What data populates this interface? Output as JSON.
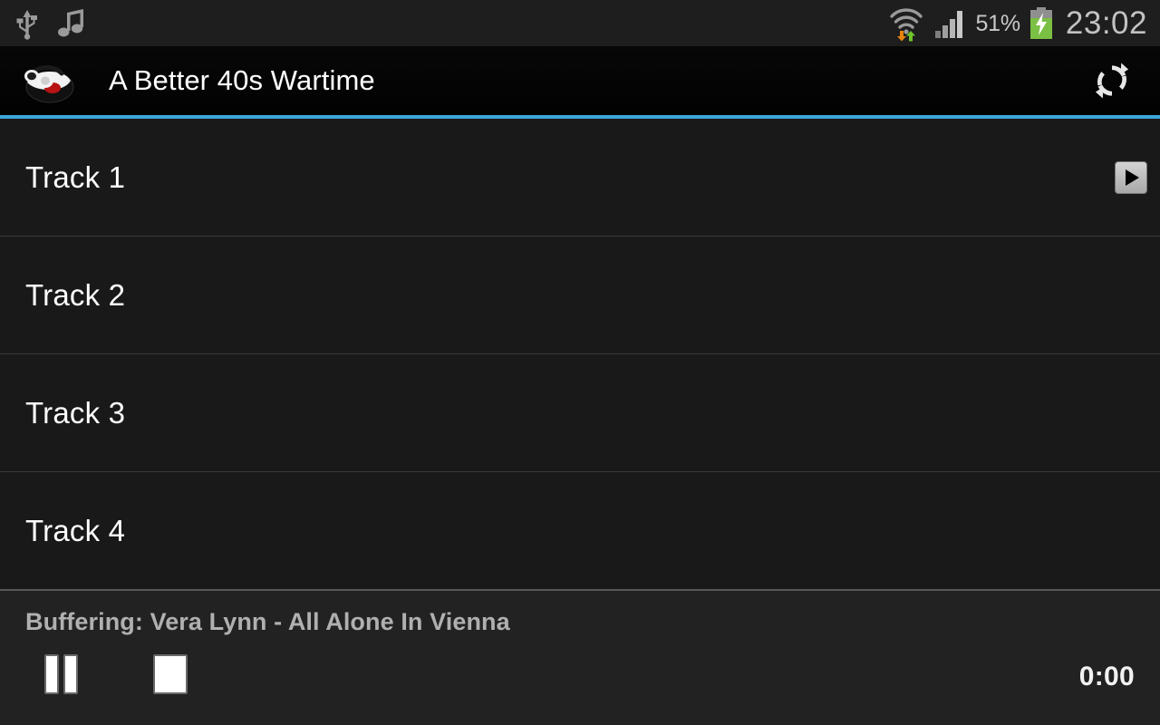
{
  "status_bar": {
    "icons_left": [
      {
        "name": "usb-icon",
        "label": "USB connected"
      },
      {
        "name": "music-note-icon",
        "label": "Music playing"
      }
    ],
    "wifi_icon": "wifi-transfer-icon",
    "signal_icon": "cellular-signal-icon",
    "battery_percent": "51%",
    "battery_icon": "battery-charging-icon",
    "clock": "23:02",
    "background": "#1e1e1e",
    "text_color": "#c2c2c2"
  },
  "action_bar": {
    "app_icon": "radio-headphones-icon",
    "title": "A Better 40s Wartime",
    "spinner_indicator": "dropdown-triangle-icon",
    "refresh_icon": "refresh-sync-icon",
    "divider_color": "#3ba7d8",
    "background": "#050505"
  },
  "track_list": {
    "rows": [
      {
        "label": "Track 1",
        "has_play_button": true,
        "play_icon": "play-triangle-icon"
      },
      {
        "label": "Track 2",
        "has_play_button": false
      },
      {
        "label": "Track 3",
        "has_play_button": false
      },
      {
        "label": "Track 4",
        "has_play_button": false
      }
    ],
    "background": "#191919",
    "separator_color": "#3a3a3a"
  },
  "player": {
    "status_text": "Buffering: Vera Lynn - All Alone In Vienna",
    "pause_icon": "pause-icon",
    "stop_icon": "stop-icon",
    "elapsed_time": "0:00",
    "background": "#222222"
  }
}
